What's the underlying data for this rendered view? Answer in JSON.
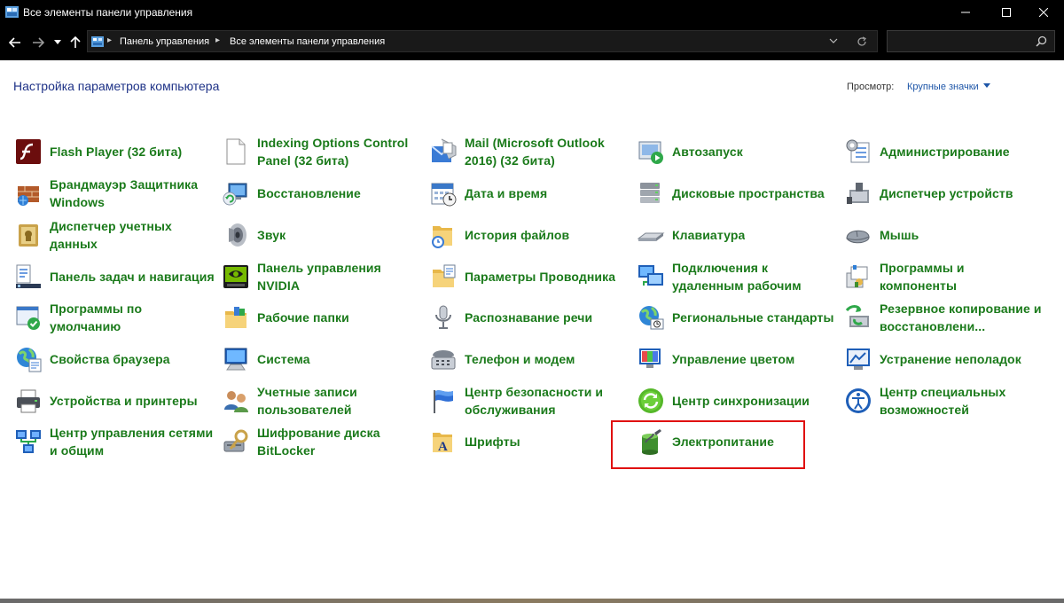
{
  "window": {
    "title": "Все элементы панели управления",
    "controls": [
      "minimize",
      "maximize",
      "close"
    ]
  },
  "address_bar": {
    "breadcrumbs": [
      "Панель управления",
      "Все элементы панели управления"
    ],
    "search_placeholder": ""
  },
  "header": {
    "title": "Настройка параметров компьютера",
    "view_label": "Просмотр:",
    "view_value": "Крупные значки"
  },
  "items": [
    {
      "label": "Flash Player (32 бита)",
      "icon": "flash-icon"
    },
    {
      "label": "Брандмауэр Защитника Windows",
      "icon": "firewall-icon"
    },
    {
      "label": "Диспетчер учетных данных",
      "icon": "credential-icon"
    },
    {
      "label": "Панель задач и навигация",
      "icon": "taskbar-icon"
    },
    {
      "label": "Программы по умолчанию",
      "icon": "default-programs-icon"
    },
    {
      "label": "Свойства браузера",
      "icon": "internet-options-icon"
    },
    {
      "label": "Устройства и принтеры",
      "icon": "printer-icon"
    },
    {
      "label": "Центр управления сетями и общим",
      "icon": "network-icon"
    },
    {
      "label": "Indexing Options Control Panel (32 бита)",
      "icon": "document-icon"
    },
    {
      "label": "Восстановление",
      "icon": "recovery-icon"
    },
    {
      "label": "Звук",
      "icon": "speaker-icon"
    },
    {
      "label": "Панель управления NVIDIA",
      "icon": "nvidia-icon"
    },
    {
      "label": "Рабочие папки",
      "icon": "work-folders-icon"
    },
    {
      "label": "Система",
      "icon": "system-icon"
    },
    {
      "label": "Учетные записи пользователей",
      "icon": "users-icon"
    },
    {
      "label": "Шифрование диска BitLocker",
      "icon": "bitlocker-icon"
    },
    {
      "label": "Mail (Microsoft Outlook 2016) (32 бита)",
      "icon": "mail-icon"
    },
    {
      "label": "Дата и время",
      "icon": "datetime-icon"
    },
    {
      "label": "История файлов",
      "icon": "file-history-icon"
    },
    {
      "label": "Параметры Проводника",
      "icon": "explorer-options-icon"
    },
    {
      "label": "Распознавание речи",
      "icon": "microphone-icon"
    },
    {
      "label": "Телефон и модем",
      "icon": "phone-icon"
    },
    {
      "label": "Центр безопасности и обслуживания",
      "icon": "security-flag-icon"
    },
    {
      "label": "Шрифты",
      "icon": "fonts-icon"
    },
    {
      "label": "Автозапуск",
      "icon": "autoplay-icon"
    },
    {
      "label": "Дисковые пространства",
      "icon": "storage-icon"
    },
    {
      "label": "Клавиатура",
      "icon": "keyboard-icon"
    },
    {
      "label": "Подключения к удаленным рабочим",
      "icon": "remote-desktop-icon"
    },
    {
      "label": "Региональные стандарты",
      "icon": "region-icon"
    },
    {
      "label": "Управление цветом",
      "icon": "color-management-icon"
    },
    {
      "label": "Центр синхронизации",
      "icon": "sync-icon"
    },
    {
      "label": "Электропитание",
      "icon": "power-icon"
    },
    {
      "label": "Администрирование",
      "icon": "admin-tools-icon"
    },
    {
      "label": "Диспетчер устройств",
      "icon": "device-manager-icon"
    },
    {
      "label": "Мышь",
      "icon": "mouse-icon"
    },
    {
      "label": "Программы и компоненты",
      "icon": "programs-icon"
    },
    {
      "label": "Резервное копирование и восстановлени...",
      "icon": "backup-icon"
    },
    {
      "label": "Устранение неполадок",
      "icon": "troubleshoot-icon"
    },
    {
      "label": "Центр специальных возможностей",
      "icon": "accessibility-icon"
    }
  ],
  "colors": {
    "link_green": "#1a7a1a",
    "heading_blue": "#1e3287",
    "highlight_red": "#e01010",
    "titlebar_bg": "#000000"
  }
}
